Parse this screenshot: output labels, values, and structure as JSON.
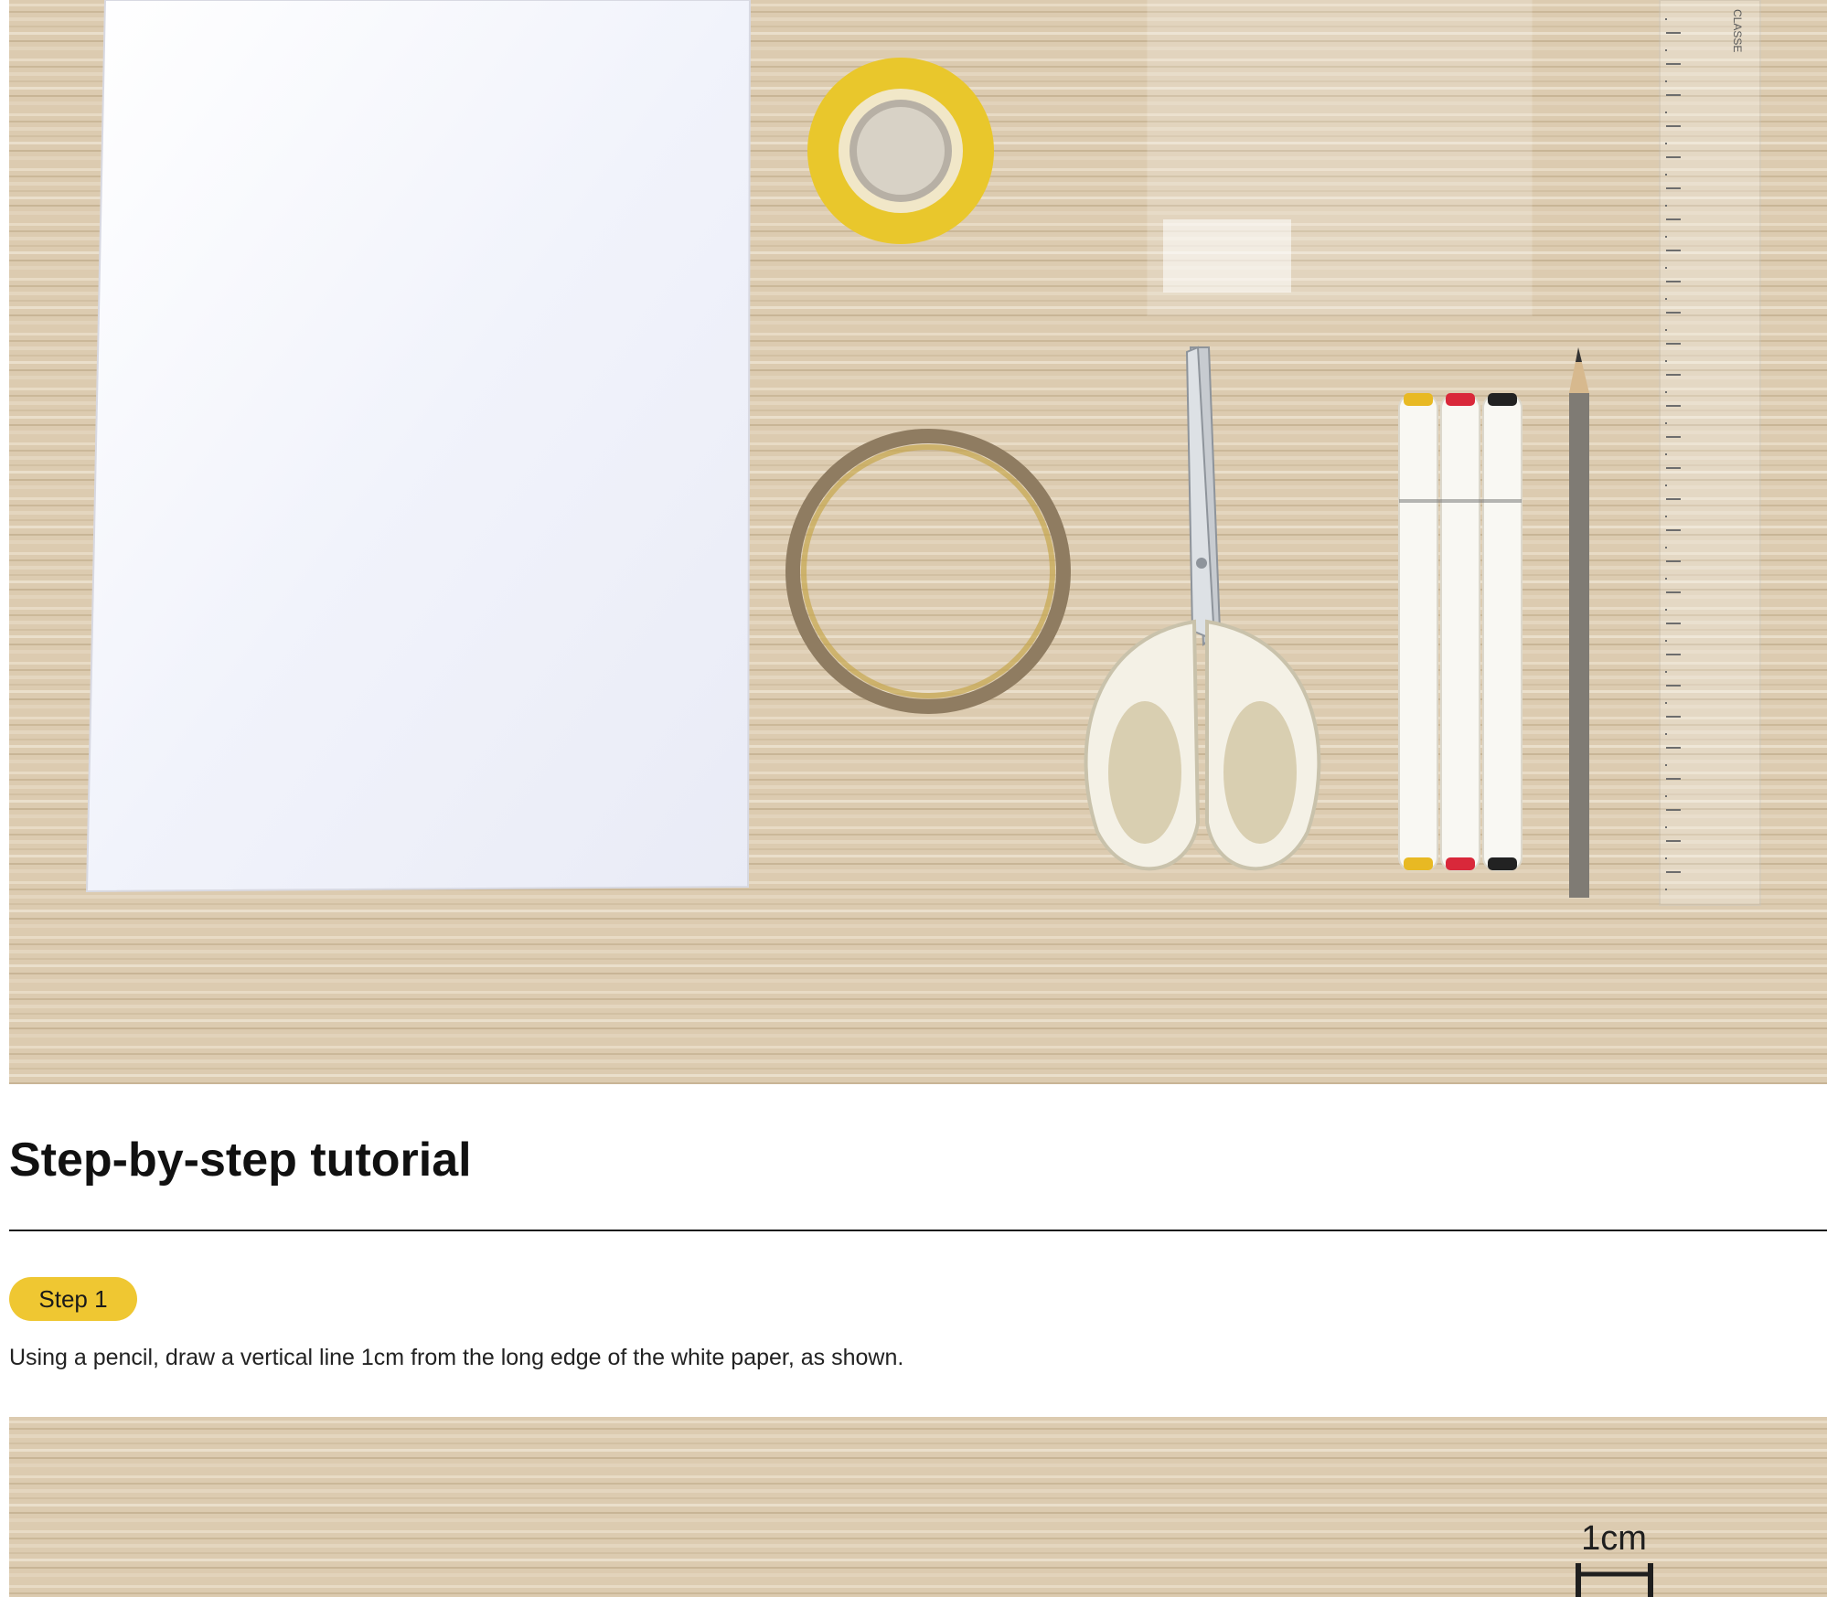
{
  "materials_photo": {
    "ruler_brand": "CLASSE"
  },
  "tutorial": {
    "heading": "Step-by-step tutorial",
    "steps": [
      {
        "badge": "Step 1",
        "instruction": "Using a pencil, draw a vertical line 1cm from the long edge of the white paper, as shown."
      }
    ]
  },
  "step1_photo": {
    "measure_label": "1cm"
  },
  "colors": {
    "accent": "#efc732",
    "rule": "#1a1a1a",
    "wood": "#dcccb2"
  }
}
